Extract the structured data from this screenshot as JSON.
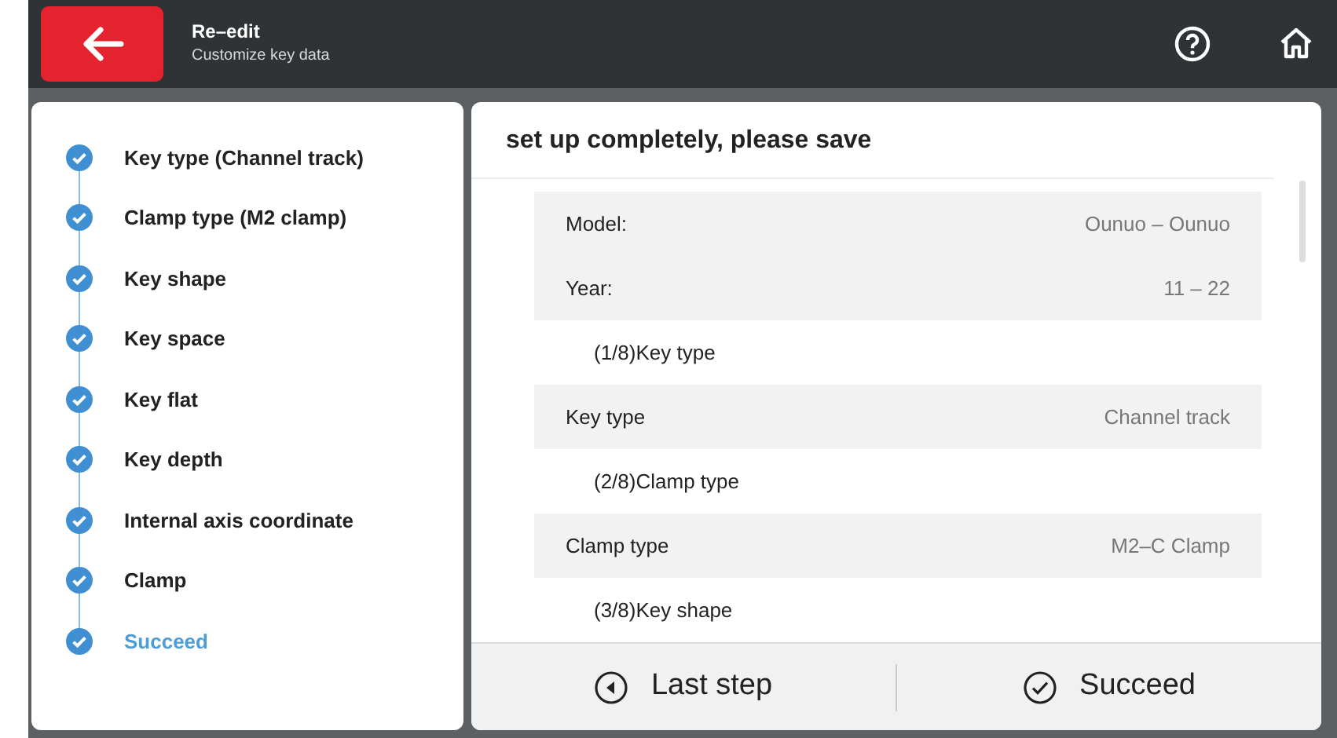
{
  "header": {
    "title": "Re–edit",
    "subtitle": "Customize key data"
  },
  "steps": [
    {
      "label": "Key type (Channel track)",
      "done": true,
      "selected": false
    },
    {
      "label": "Clamp type (M2 clamp)",
      "done": true,
      "selected": false
    },
    {
      "label": "Key shape",
      "done": true,
      "selected": false
    },
    {
      "label": "Key space",
      "done": true,
      "selected": false
    },
    {
      "label": "Key flat",
      "done": true,
      "selected": false
    },
    {
      "label": "Key depth",
      "done": true,
      "selected": false
    },
    {
      "label": "Internal axis coordinate",
      "done": true,
      "selected": false
    },
    {
      "label": "Clamp",
      "done": true,
      "selected": false
    },
    {
      "label": "Succeed",
      "done": true,
      "selected": true
    }
  ],
  "summary": {
    "title": "set up completely, please save",
    "rows": [
      {
        "kind": "field",
        "label": "Model:",
        "value": "Ounuo – Ounuo"
      },
      {
        "kind": "field",
        "label": "Year:",
        "value": "11 – 22"
      },
      {
        "kind": "section",
        "label": "(1/8)Key type"
      },
      {
        "kind": "field",
        "label": "Key type",
        "value": "Channel track"
      },
      {
        "kind": "section",
        "label": "(2/8)Clamp type"
      },
      {
        "kind": "field",
        "label": "Clamp type",
        "value": "M2–C Clamp"
      },
      {
        "kind": "section",
        "label": "(3/8)Key shape"
      }
    ]
  },
  "buttons": [
    {
      "kind": "back",
      "label": "Last step"
    },
    {
      "kind": "confirm",
      "label": "Succeed"
    }
  ]
}
